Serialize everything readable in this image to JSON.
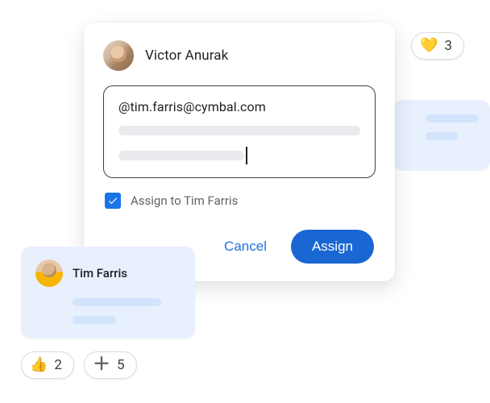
{
  "commenter": {
    "name": "Victor Anurak"
  },
  "comment": {
    "mention_text": "@tim.farris@cymbal.com"
  },
  "assign": {
    "checked": true,
    "label": "Assign to Tim Farris"
  },
  "actions": {
    "cancel": "Cancel",
    "assign": "Assign"
  },
  "assignee_card": {
    "name": "Tim Farris"
  },
  "reactions": {
    "heart": {
      "emoji": "💛",
      "count": "3"
    },
    "thumbs": {
      "emoji": "👍",
      "count": "2"
    },
    "plus": {
      "emoji": "＋",
      "count": "5"
    }
  }
}
